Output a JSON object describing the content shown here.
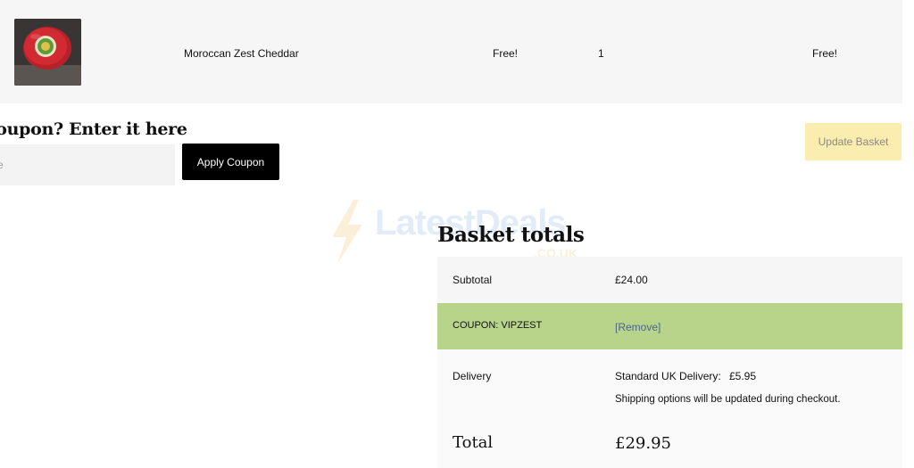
{
  "cart_item": {
    "name": "Moroccan Zest Cheddar",
    "price": "Free!",
    "quantity": "1",
    "subtotal": "Free!"
  },
  "coupon": {
    "heading": "coupon? Enter it here",
    "input_placeholder": "e",
    "apply_label": "Apply Coupon"
  },
  "update_label": "Update Basket",
  "watermark": {
    "brand": "LatestDeals",
    "domain": ".CO.UK"
  },
  "totals": {
    "title": "Basket totals",
    "subtotal_label": "Subtotal",
    "subtotal_value": "£24.00",
    "coupon_label": "COUPON: VIPZEST",
    "coupon_remove": "[Remove]",
    "delivery_label": "Delivery",
    "delivery_method": "Standard UK Delivery:",
    "delivery_amount": "£5.95",
    "delivery_note": "Shipping options will be updated during checkout.",
    "total_label": "Total",
    "total_value": "£29.95"
  },
  "colors": {
    "coupon_row": "#b7d48a",
    "update_button": "#fbecb0",
    "apply_button": "#000000",
    "remove_link": "#4a6490"
  }
}
